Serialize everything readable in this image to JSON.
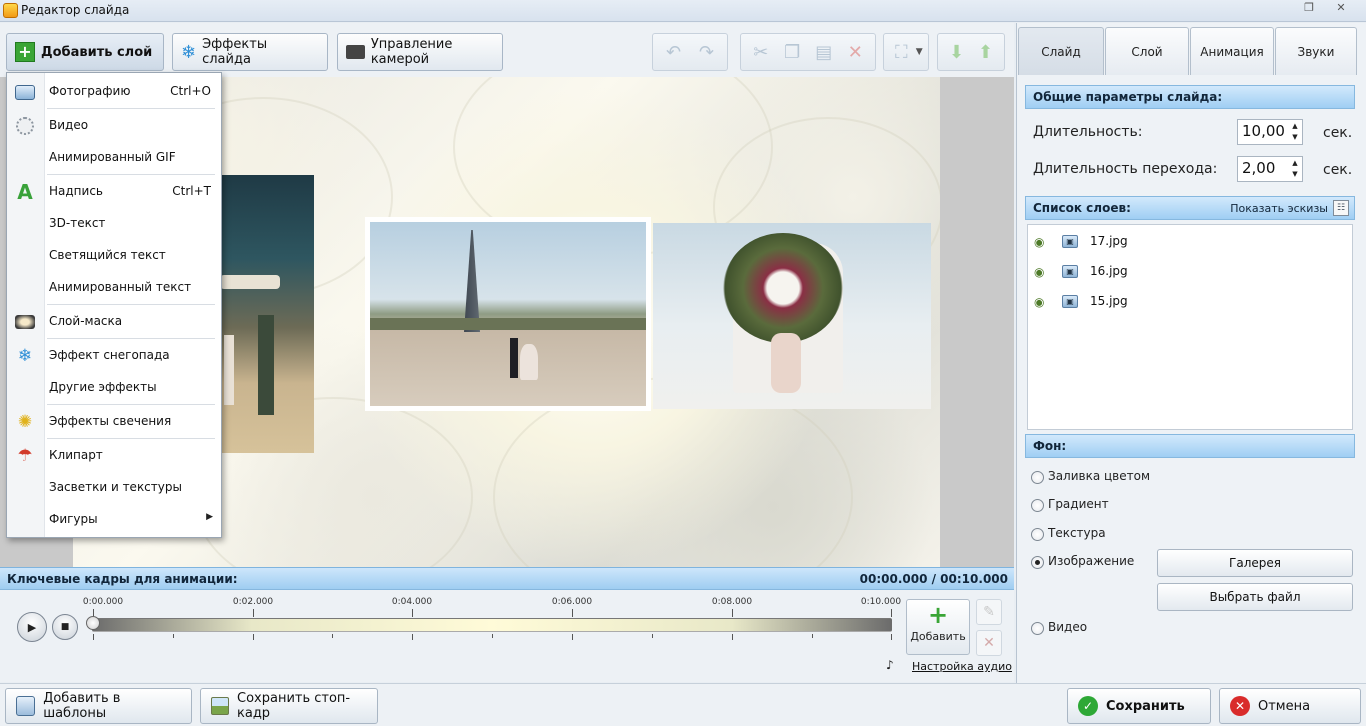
{
  "window": {
    "title": "Редактор слайда"
  },
  "toolbar": {
    "add_layer": "Добавить слой",
    "slide_effects": "Эффекты слайда",
    "camera_control": "Управление камерой"
  },
  "menu": {
    "items": [
      {
        "label": "Фотографию",
        "shortcut": "Ctrl+O",
        "icon": "photo-icon"
      },
      {
        "label": "Видео",
        "shortcut": "",
        "icon": "video-icon"
      },
      {
        "label": "Анимированный GIF",
        "shortcut": "",
        "icon": ""
      },
      {
        "label": "Надпись",
        "shortcut": "Ctrl+T",
        "icon": "text-icon"
      },
      {
        "label": "3D-текст",
        "shortcut": "",
        "icon": ""
      },
      {
        "label": "Светящийся текст",
        "shortcut": "",
        "icon": ""
      },
      {
        "label": "Анимированный текст",
        "shortcut": "",
        "icon": ""
      },
      {
        "label": "Слой-маска",
        "shortcut": "",
        "icon": "mask-icon"
      },
      {
        "label": "Эффект снегопада",
        "shortcut": "",
        "icon": "snowflake-icon"
      },
      {
        "label": "Другие эффекты",
        "shortcut": "",
        "icon": ""
      },
      {
        "label": "Эффекты свечения",
        "shortcut": "",
        "icon": "sparkle-icon"
      },
      {
        "label": "Клипарт",
        "shortcut": "",
        "icon": "umbrella-icon"
      },
      {
        "label": "Засветки и текстуры",
        "shortcut": "",
        "icon": ""
      },
      {
        "label": "Фигуры",
        "shortcut": "",
        "icon": ""
      }
    ]
  },
  "keyframes": {
    "title": "Ключевые кадры для анимации:",
    "time": "00:00.000 / 00:10.000",
    "ticks": [
      "0:00.000",
      "0:02.000",
      "0:04.000",
      "0:06.000",
      "0:08.000",
      "0:10.000"
    ],
    "add_label": "Добавить",
    "audio_link": "Настройка аудио"
  },
  "tabs": [
    "Слайд",
    "Слой",
    "Анимация",
    "Звуки"
  ],
  "slide_params": {
    "header": "Общие параметры слайда:",
    "duration_label": "Длительность:",
    "duration_value": "10,00",
    "transition_label": "Длительность перехода:",
    "transition_value": "2,00",
    "unit": "сек."
  },
  "layers": {
    "header": "Список слоев:",
    "show_thumbs": "Показать эскизы",
    "items": [
      "17.jpg",
      "16.jpg",
      "15.jpg"
    ]
  },
  "background": {
    "header": "Фон:",
    "options": [
      "Заливка цветом",
      "Градиент",
      "Текстура",
      "Изображение",
      "Видео"
    ],
    "selected": "Изображение",
    "gallery_btn": "Галерея",
    "choose_file_btn": "Выбрать файл"
  },
  "bottom": {
    "add_templates": "Добавить в шаблоны",
    "save_frame": "Сохранить стоп-кадр",
    "save": "Сохранить",
    "cancel": "Отмена"
  },
  "colors": {
    "accent_header": "#9fcef3",
    "ok_green": "#2ea836",
    "cancel_red": "#d92b2b"
  }
}
